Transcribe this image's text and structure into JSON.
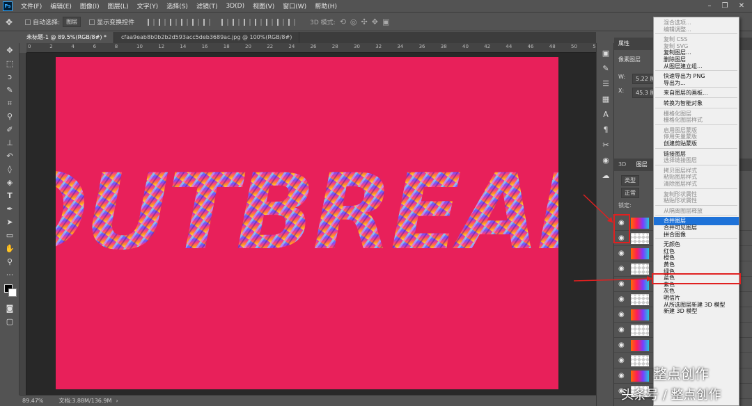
{
  "menubar": {
    "items": [
      "文件(F)",
      "编辑(E)",
      "图像(I)",
      "图层(L)",
      "文字(Y)",
      "选择(S)",
      "滤镜(T)",
      "3D(D)",
      "视图(V)",
      "窗口(W)",
      "帮助(H)"
    ],
    "logo": "Ps"
  },
  "options": {
    "auto_select_label": "自动选择:",
    "auto_select_value": "图层",
    "show_transform_label": "显示变换控件",
    "mode_label": "3D 模式:"
  },
  "tabs": [
    {
      "label": "未标题-1 @ 89.5%(RGB/8#) *"
    },
    {
      "label": "cfaa9eab8b0b2b2d593acc5deb3689ac.jpg @ 100%(RGB/8#)"
    }
  ],
  "ruler": {
    "ticks": [
      "0",
      "2",
      "4",
      "6",
      "8",
      "10",
      "12",
      "14",
      "16",
      "18",
      "20",
      "22",
      "24",
      "26",
      "28",
      "30",
      "32",
      "34",
      "36",
      "38",
      "40",
      "42",
      "44",
      "46",
      "48",
      "50",
      "52"
    ]
  },
  "canvas": {
    "text": "OUTBREAK",
    "background": "#e8205a"
  },
  "status": {
    "zoom": "89.47%",
    "doc": "文档:3.88M/136.9M"
  },
  "properties": {
    "title": "属性",
    "kind": "像素图层",
    "w_label": "W:",
    "w_value": "5.22 厘米",
    "x_label": "X:",
    "x_value": "45.3 厘米"
  },
  "layers": {
    "tabs": [
      "3D",
      "图层"
    ],
    "filter": "类型",
    "blend": "正常",
    "lock": "锁定:"
  },
  "context_menu": [
    {
      "label": "混合选项...",
      "state": "dis"
    },
    {
      "label": "编辑调整...",
      "state": "dis"
    },
    {
      "sep": true
    },
    {
      "label": "复制 CSS",
      "state": "dis"
    },
    {
      "label": "复制 SVG",
      "state": "dis"
    },
    {
      "label": "复制图层...",
      "state": "en"
    },
    {
      "label": "删除图层",
      "state": "en"
    },
    {
      "label": "从图层建立组...",
      "state": "en"
    },
    {
      "sep": true
    },
    {
      "label": "快速导出为 PNG",
      "state": "en"
    },
    {
      "label": "导出为...",
      "state": "en"
    },
    {
      "sep": true
    },
    {
      "label": "来自图层的画板...",
      "state": "en"
    },
    {
      "sep": true
    },
    {
      "label": "转换为智能对象",
      "state": "en"
    },
    {
      "sep": true
    },
    {
      "label": "栅格化图层",
      "state": "dis"
    },
    {
      "label": "栅格化图层样式",
      "state": "dis"
    },
    {
      "sep": true
    },
    {
      "label": "启用图层蒙版",
      "state": "dis"
    },
    {
      "label": "停用矢量蒙版",
      "state": "dis"
    },
    {
      "label": "创建剪贴蒙版",
      "state": "en"
    },
    {
      "sep": true
    },
    {
      "label": "链接图层",
      "state": "en"
    },
    {
      "label": "选择链接图层",
      "state": "dis"
    },
    {
      "sep": true
    },
    {
      "label": "拷贝图层样式",
      "state": "dis"
    },
    {
      "label": "粘贴图层样式",
      "state": "dis"
    },
    {
      "label": "清除图层样式",
      "state": "dis"
    },
    {
      "sep": true
    },
    {
      "label": "复制形状属性",
      "state": "dis"
    },
    {
      "label": "粘贴形状属性",
      "state": "dis"
    },
    {
      "sep": true
    },
    {
      "label": "从隔离图层释放",
      "state": "dis"
    },
    {
      "sep": true
    },
    {
      "label": "合并图层",
      "state": "hl"
    },
    {
      "label": "合并可见图层",
      "state": "en"
    },
    {
      "label": "拼合图像",
      "state": "en"
    },
    {
      "sep": true
    },
    {
      "label": "无颜色",
      "state": "en"
    },
    {
      "label": "红色",
      "state": "en"
    },
    {
      "label": "橙色",
      "state": "en"
    },
    {
      "label": "黄色",
      "state": "en"
    },
    {
      "label": "绿色",
      "state": "en"
    },
    {
      "label": "蓝色",
      "state": "en"
    },
    {
      "label": "紫色",
      "state": "en"
    },
    {
      "label": "灰色",
      "state": "en"
    },
    {
      "label": "明信片",
      "state": "en"
    },
    {
      "label": "从所选图层新建 3D 模型",
      "state": "en"
    },
    {
      "label": "新建 3D 模型",
      "state": "en"
    }
  ],
  "watermark": {
    "line1": "整点创作",
    "line2": "头条号 / 整点创作"
  }
}
